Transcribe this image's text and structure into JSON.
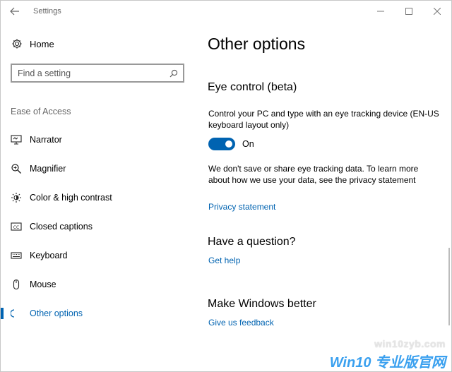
{
  "window": {
    "title": "Settings",
    "controls": {
      "minimize": "—",
      "maximize": "☐",
      "close": "✕"
    }
  },
  "sidebar": {
    "home_label": "Home",
    "search": {
      "placeholder": "Find a setting"
    },
    "section_label": "Ease of Access",
    "items": [
      {
        "label": "Narrator",
        "icon": "narrator-icon"
      },
      {
        "label": "Magnifier",
        "icon": "magnifier-icon"
      },
      {
        "label": "Color & high contrast",
        "icon": "color-contrast-icon"
      },
      {
        "label": "Closed captions",
        "icon": "closed-captions-icon"
      },
      {
        "label": "Keyboard",
        "icon": "keyboard-icon"
      },
      {
        "label": "Mouse",
        "icon": "mouse-icon"
      },
      {
        "label": "Other options",
        "icon": "other-options-icon",
        "active": true
      }
    ]
  },
  "main": {
    "page_title": "Other options",
    "eye_control": {
      "heading": "Eye control (beta)",
      "description": "Control your PC and type with an eye tracking device (EN-US keyboard layout only)",
      "toggle_state": "On",
      "privacy_text": "We don't save or share eye tracking data. To learn more about how we use your data, see the privacy statement",
      "privacy_link": "Privacy statement"
    },
    "question": {
      "heading": "Have a question?",
      "link": "Get help"
    },
    "better": {
      "heading": "Make Windows better",
      "link": "Give us feedback"
    }
  },
  "watermark": {
    "url": "win10zyb.com",
    "brand": "Win10 专业版官网"
  },
  "colors": {
    "accent": "#0063b1"
  }
}
